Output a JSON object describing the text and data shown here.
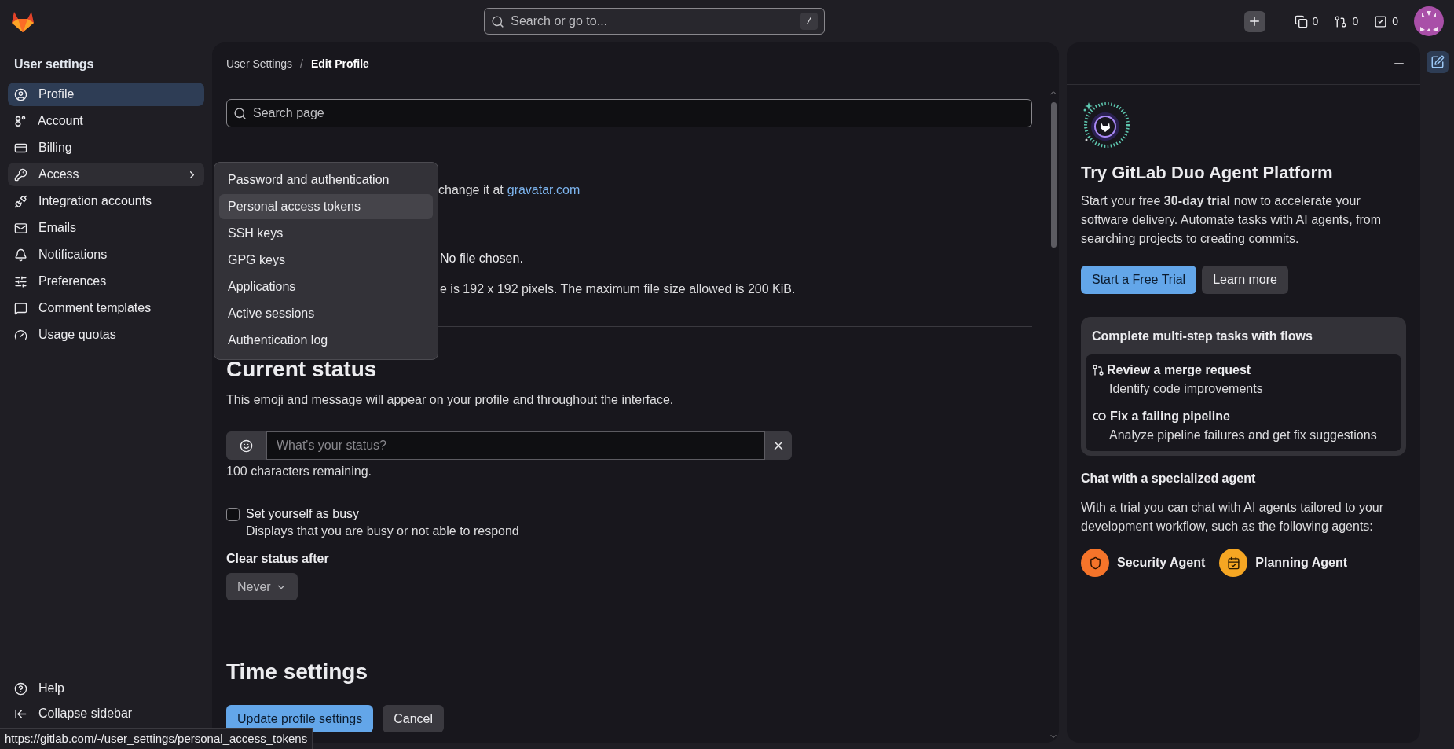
{
  "topbar": {
    "search_placeholder": "Search or go to...",
    "shortcut": "/",
    "counters": [
      {
        "count": "0"
      },
      {
        "count": "0"
      },
      {
        "count": "0"
      }
    ]
  },
  "sidebar": {
    "title": "User settings",
    "items": [
      {
        "label": "Profile",
        "kind": "link",
        "selected": true,
        "highlighted": false
      },
      {
        "label": "Account",
        "kind": "link",
        "selected": false,
        "highlighted": false
      },
      {
        "label": "Billing",
        "kind": "link",
        "selected": false,
        "highlighted": false
      },
      {
        "label": "Access",
        "kind": "submenu",
        "selected": false,
        "highlighted": true
      },
      {
        "label": "Integration accounts",
        "kind": "link",
        "selected": false,
        "highlighted": false
      },
      {
        "label": "Emails",
        "kind": "link",
        "selected": false,
        "highlighted": false
      },
      {
        "label": "Notifications",
        "kind": "link",
        "selected": false,
        "highlighted": false
      },
      {
        "label": "Preferences",
        "kind": "link",
        "selected": false,
        "highlighted": false
      },
      {
        "label": "Comment templates",
        "kind": "link",
        "selected": false,
        "highlighted": false
      },
      {
        "label": "Usage quotas",
        "kind": "link",
        "selected": false,
        "highlighted": false
      }
    ],
    "footer": [
      {
        "label": "Help"
      },
      {
        "label": "Collapse sidebar"
      }
    ]
  },
  "access_menu": {
    "items": [
      {
        "label": "Password and authentication",
        "highlighted": false
      },
      {
        "label": "Personal access tokens",
        "highlighted": true
      },
      {
        "label": "SSH keys",
        "highlighted": false
      },
      {
        "label": "GPG keys",
        "highlighted": false
      },
      {
        "label": "Applications",
        "highlighted": false
      },
      {
        "label": "Active sessions",
        "highlighted": false
      },
      {
        "label": "Authentication log",
        "highlighted": false
      }
    ]
  },
  "breadcrumb": {
    "separator": "/",
    "items": [
      {
        "label": "User Settings",
        "current": false
      },
      {
        "label": "Edit Profile",
        "current": true
      }
    ]
  },
  "page_search": {
    "placeholder": "Search page"
  },
  "public_avatar": {
    "note": "change it at",
    "link": "gravatar.com",
    "file_status": "No file chosen.",
    "size_note": "e is 192 x 192 pixels. The maximum file size allowed is 200 KiB."
  },
  "current_status": {
    "heading": "Current status",
    "description": "This emoji and message will appear on your profile and throughout the interface.",
    "status_field": {
      "placeholder": "What's your status?"
    },
    "remaining": "100 characters remaining.",
    "busy": {
      "label": "Set yourself as busy",
      "help": "Displays that you are busy or not able to respond",
      "checked": false
    },
    "clear_after": {
      "label": "Clear status after",
      "value": "Never"
    }
  },
  "time_settings": {
    "heading": "Time settings"
  },
  "actions": [
    {
      "label": "Update profile settings",
      "kind": "primary"
    },
    {
      "label": "Cancel",
      "kind": "secondary"
    }
  ],
  "duo_panel": {
    "title": "Try GitLab Duo Agent Platform",
    "intro": "Start your free **30-day trial** now to accelerate your software delivery. Automate tasks with AI agents, from searching projects to creating commits.",
    "buttons": [
      {
        "label": "Start a Free Trial",
        "kind": "primary"
      },
      {
        "label": "Learn more",
        "kind": "secondary"
      }
    ],
    "flows": {
      "title": "Complete multi-step tasks with flows",
      "items": [
        {
          "kind": "merge_request",
          "title": "Review a merge request",
          "description": "Identify code improvements"
        },
        {
          "kind": "pipeline",
          "title": "Fix a failing pipeline",
          "description": "Analyze pipeline failures and get fix suggestions"
        }
      ]
    },
    "chat": {
      "title": "Chat with a specialized agent",
      "description": "With a trial you can chat with AI agents tailored to your development workflow, such as the following agents:",
      "agents": [
        {
          "name": "Security Agent",
          "kind": "security",
          "color": "#f5742a"
        },
        {
          "name": "Planning Agent",
          "kind": "planning",
          "color": "#f5a623"
        }
      ]
    }
  },
  "status_url": "https://gitlab.com/-/user_settings/personal_access_tokens"
}
